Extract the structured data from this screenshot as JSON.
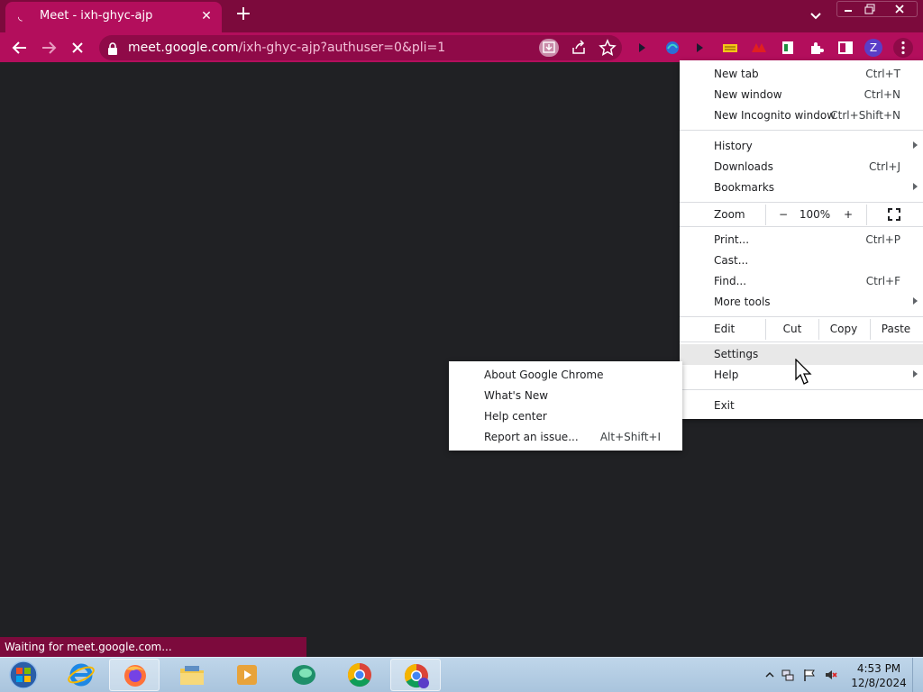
{
  "browser": {
    "tab": {
      "title": "Meet - ixh-ghyc-ajp",
      "favicon": "meet-loading-icon"
    },
    "new_tab_glyph": "+",
    "url": {
      "host": "meet.google.com",
      "path": "/ixh-ghyc-ajp?authuser=0&pli=1"
    },
    "colors": {
      "frame": "#7c0a3c",
      "toolbar": "#b30e5c",
      "content": "#202124"
    },
    "profile_initial": "Z",
    "status_text": "Waiting for meet.google.com..."
  },
  "menu": {
    "new_tab": {
      "label": "New tab",
      "shortcut": "Ctrl+T"
    },
    "new_window": {
      "label": "New window",
      "shortcut": "Ctrl+N"
    },
    "new_incognito": {
      "label": "New Incognito window",
      "shortcut": "Ctrl+Shift+N"
    },
    "history": {
      "label": "History"
    },
    "downloads": {
      "label": "Downloads",
      "shortcut": "Ctrl+J"
    },
    "bookmarks": {
      "label": "Bookmarks"
    },
    "zoom": {
      "label": "Zoom",
      "minus": "−",
      "value": "100%",
      "plus": "+"
    },
    "print": {
      "label": "Print...",
      "shortcut": "Ctrl+P"
    },
    "cast": {
      "label": "Cast..."
    },
    "find": {
      "label": "Find...",
      "shortcut": "Ctrl+F"
    },
    "more_tools": {
      "label": "More tools"
    },
    "edit": {
      "label": "Edit",
      "cut": "Cut",
      "copy": "Copy",
      "paste": "Paste"
    },
    "settings": {
      "label": "Settings"
    },
    "help": {
      "label": "Help"
    },
    "exit": {
      "label": "Exit"
    }
  },
  "help_submenu": {
    "about": {
      "label": "About Google Chrome"
    },
    "whats_new": {
      "label": "What's New"
    },
    "help_center": {
      "label": "Help center"
    },
    "report_issue": {
      "label": "Report an issue...",
      "shortcut": "Alt+Shift+I"
    }
  },
  "taskbar": {
    "clock_time": "4:53 PM",
    "clock_date": "12/8/2024",
    "items": [
      "internet-explorer",
      "firefox",
      "file-explorer",
      "media-player",
      "app-green",
      "chrome",
      "chrome-profile-z"
    ]
  }
}
